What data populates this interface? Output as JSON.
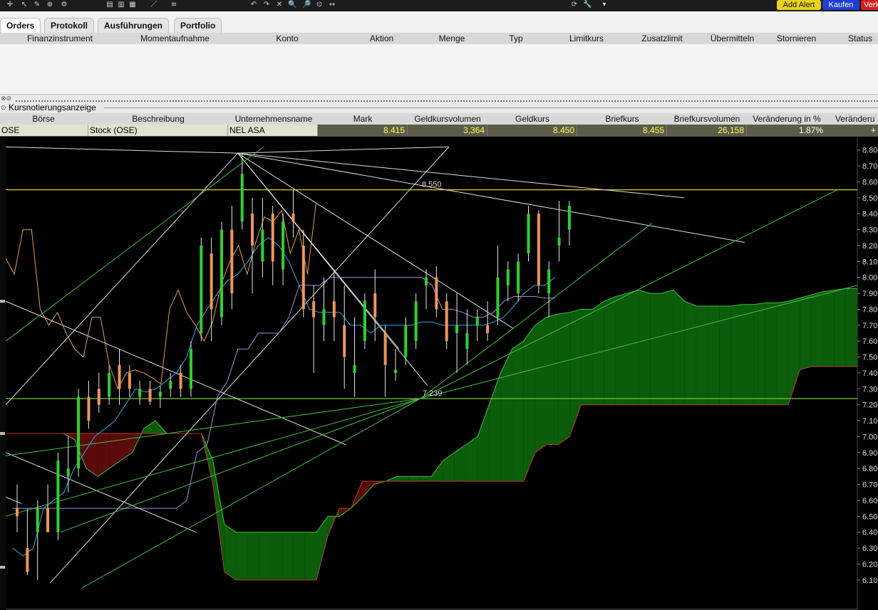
{
  "toolbar": {
    "icons": [
      "crosshair-icon",
      "arrow-icon",
      "pencil-icon",
      "zoom-icon",
      "settings-icon",
      "chart-bar-icon",
      "chart-candle-icon",
      "chart-line-icon",
      "draw-line-icon",
      "fib-icon",
      "undo-icon",
      "redo-icon",
      "delete-icon",
      "zoom-in-icon",
      "zoom-out-icon",
      "zoom-reset-icon",
      "scroll-icon",
      "refresh-icon",
      "wrench-icon",
      "dropdown-icon"
    ],
    "add_alert": "Add Alert",
    "kaufen": "Kaufen",
    "verkaufen": "Verk",
    "colors": {
      "add_alert_bg": "#e8d21a",
      "kaufen_bg": "#1d3fd6",
      "verkaufen_bg": "#d81c1c"
    }
  },
  "tabs": [
    "Orders",
    "Protokoll",
    "Ausführungen",
    "Portfolio"
  ],
  "orders": {
    "columns": [
      "Finanzinstrument",
      "Momentaufnahme",
      "Konto",
      "Aktion",
      "Menge",
      "Typ",
      "Limitkurs",
      "Zusatzlimit",
      "Übermitteln",
      "Stornieren",
      "Status"
    ]
  },
  "kurs": {
    "title": "Kursnotierungsanzeige",
    "columns": [
      "Börse",
      "Beschreibung",
      "Unternehmensname",
      "Mark",
      "Geldkursvolumen",
      "Geldkurs",
      "Briefkurs",
      "Briefkursvolumen",
      "Veränderung in %",
      "Veränderu"
    ],
    "row": {
      "boerse": "OSE",
      "beschreibung": "Stock (OSE)",
      "unternehmensname": "NEL ASA",
      "mark": "8.415",
      "geldkursvolumen": "3,364",
      "geldkurs": "8.450",
      "briefkurs": "8.455",
      "briefkursvolumen": "26,158",
      "veraenderung_pct": "1.87%",
      "veraenderung": "+"
    }
  },
  "chart_data": {
    "type": "candlestick",
    "y_ticks": [
      "8.80",
      "8.70",
      "8.60",
      "8.50",
      "8.40",
      "8.30",
      "8.20",
      "8.10",
      "8.00",
      "7.90",
      "7.80",
      "7.70",
      "7.60",
      "7.50",
      "7.40",
      "7.30",
      "7.20",
      "7.10",
      "7.00",
      "6.90",
      "6.80",
      "6.70",
      "6.60",
      "6.50",
      "6.40",
      "6.30",
      "6.20",
      "6.10"
    ],
    "ylim": [
      6.05,
      8.83
    ],
    "annotations": [
      {
        "text": "8.550",
        "price": 8.55
      },
      {
        "text": "7.239",
        "price": 7.239
      }
    ],
    "horizontal_lines": [
      {
        "price": 8.55,
        "color": "#e0d020"
      },
      {
        "price": 7.239,
        "color": "#7ac33a"
      }
    ],
    "candles": [
      {
        "o": 6.55,
        "h": 6.7,
        "l": 6.4,
        "c": 6.5
      },
      {
        "o": 6.3,
        "h": 6.55,
        "l": 6.13,
        "c": 6.15
      },
      {
        "o": 6.4,
        "h": 6.6,
        "l": 6.1,
        "c": 6.55
      },
      {
        "o": 6.55,
        "h": 6.7,
        "l": 6.4,
        "c": 6.4
      },
      {
        "o": 6.4,
        "h": 6.9,
        "l": 6.35,
        "c": 6.85
      },
      {
        "o": 6.75,
        "h": 7.0,
        "l": 6.65,
        "c": 6.8
      },
      {
        "o": 6.8,
        "h": 7.3,
        "l": 6.75,
        "c": 7.25
      },
      {
        "o": 7.25,
        "h": 7.35,
        "l": 7.05,
        "c": 7.1
      },
      {
        "o": 7.3,
        "h": 7.4,
        "l": 7.15,
        "c": 7.2
      },
      {
        "o": 7.25,
        "h": 7.45,
        "l": 7.2,
        "c": 7.4
      },
      {
        "o": 7.45,
        "h": 7.55,
        "l": 7.2,
        "c": 7.3
      },
      {
        "o": 7.4,
        "h": 7.45,
        "l": 7.25,
        "c": 7.3
      },
      {
        "o": 7.25,
        "h": 7.35,
        "l": 7.2,
        "c": 7.3
      },
      {
        "o": 7.3,
        "h": 7.35,
        "l": 7.2,
        "c": 7.22
      },
      {
        "o": 7.25,
        "h": 7.32,
        "l": 7.18,
        "c": 7.28
      },
      {
        "o": 7.3,
        "h": 7.4,
        "l": 7.25,
        "c": 7.35
      },
      {
        "o": 7.4,
        "h": 7.45,
        "l": 7.25,
        "c": 7.3
      },
      {
        "o": 7.3,
        "h": 7.6,
        "l": 7.25,
        "c": 7.55
      },
      {
        "o": 7.65,
        "h": 8.25,
        "l": 7.6,
        "c": 8.2
      },
      {
        "o": 8.15,
        "h": 8.25,
        "l": 7.6,
        "c": 7.8
      },
      {
        "o": 7.75,
        "h": 8.35,
        "l": 7.7,
        "c": 8.3
      },
      {
        "o": 8.3,
        "h": 8.45,
        "l": 7.8,
        "c": 7.9
      },
      {
        "o": 8.35,
        "h": 8.78,
        "l": 8.3,
        "c": 8.65
      },
      {
        "o": 8.4,
        "h": 8.5,
        "l": 7.9,
        "c": 8.2
      },
      {
        "o": 8.1,
        "h": 8.5,
        "l": 8.0,
        "c": 8.3
      },
      {
        "o": 8.4,
        "h": 8.45,
        "l": 7.95,
        "c": 8.1
      },
      {
        "o": 8.05,
        "h": 8.4,
        "l": 7.95,
        "c": 8.35
      },
      {
        "o": 8.4,
        "h": 8.55,
        "l": 8.25,
        "c": 8.35
      },
      {
        "o": 8.2,
        "h": 8.3,
        "l": 7.75,
        "c": 7.8
      },
      {
        "o": 7.85,
        "h": 7.95,
        "l": 7.4,
        "c": 7.75
      },
      {
        "o": 7.7,
        "h": 8.0,
        "l": 7.6,
        "c": 7.8
      },
      {
        "o": 7.85,
        "h": 8.05,
        "l": 7.6,
        "c": 7.75
      },
      {
        "o": 7.7,
        "h": 7.95,
        "l": 7.3,
        "c": 7.5
      },
      {
        "o": 7.4,
        "h": 7.75,
        "l": 7.25,
        "c": 7.45
      },
      {
        "o": 7.6,
        "h": 7.9,
        "l": 7.55,
        "c": 7.85
      },
      {
        "o": 7.9,
        "h": 8.05,
        "l": 7.6,
        "c": 7.75
      },
      {
        "o": 7.65,
        "h": 7.7,
        "l": 7.25,
        "c": 7.45
      },
      {
        "o": 7.4,
        "h": 7.55,
        "l": 7.35,
        "c": 7.42
      },
      {
        "o": 7.5,
        "h": 7.75,
        "l": 7.45,
        "c": 7.7
      },
      {
        "o": 7.6,
        "h": 7.9,
        "l": 7.55,
        "c": 7.85
      },
      {
        "o": 7.95,
        "h": 8.05,
        "l": 7.8,
        "c": 8.0
      },
      {
        "o": 8.0,
        "h": 8.07,
        "l": 7.75,
        "c": 7.8
      },
      {
        "o": 7.85,
        "h": 7.9,
        "l": 7.55,
        "c": 7.6
      },
      {
        "o": 7.65,
        "h": 7.9,
        "l": 7.4,
        "c": 7.7
      },
      {
        "o": 7.55,
        "h": 7.8,
        "l": 7.45,
        "c": 7.65
      },
      {
        "o": 7.7,
        "h": 7.8,
        "l": 7.6,
        "c": 7.75
      },
      {
        "o": 7.7,
        "h": 7.85,
        "l": 7.6,
        "c": 7.65
      },
      {
        "o": 7.75,
        "h": 8.2,
        "l": 7.7,
        "c": 8.0
      },
      {
        "o": 7.95,
        "h": 8.1,
        "l": 7.85,
        "c": 8.05
      },
      {
        "o": 7.9,
        "h": 8.15,
        "l": 7.85,
        "c": 8.1
      },
      {
        "o": 8.15,
        "h": 8.45,
        "l": 8.1,
        "c": 8.4
      },
      {
        "o": 8.4,
        "h": 8.42,
        "l": 7.9,
        "c": 7.95
      },
      {
        "o": 7.9,
        "h": 8.1,
        "l": 7.75,
        "c": 8.05
      },
      {
        "o": 8.2,
        "h": 8.48,
        "l": 8.1,
        "c": 8.25
      },
      {
        "o": 8.3,
        "h": 8.48,
        "l": 8.2,
        "c": 8.45
      }
    ],
    "colors": {
      "up": "#2fd12f",
      "down": "#f0955a",
      "cloud_up": "#0b5c0b",
      "cloud_down": "#5a0a0a",
      "tenkan": "#2aa7e8",
      "kijun": "#9b8fd8",
      "chikou": "#e0a050",
      "fan_white": "#dcdcdc",
      "fan_green": "#3ec13e"
    }
  }
}
